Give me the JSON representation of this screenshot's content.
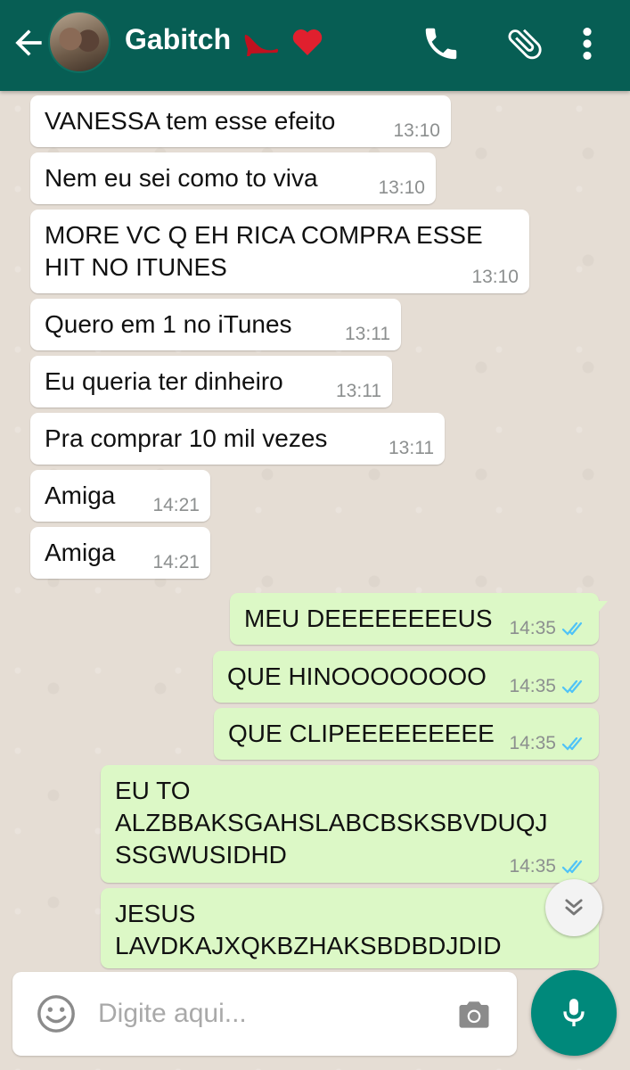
{
  "header": {
    "contact_name": "Gabitch",
    "name_emojis": [
      "high-heel-icon",
      "heart-icon"
    ],
    "icons": [
      "back-arrow-icon",
      "phone-icon",
      "paperclip-icon",
      "more-vert-icon"
    ]
  },
  "messages": [
    {
      "dir": "in",
      "text": "VANESSA tem esse efeito",
      "time": "13:10"
    },
    {
      "dir": "in",
      "text": "Nem eu sei como to viva",
      "time": "13:10"
    },
    {
      "dir": "in",
      "text": "MORE VC Q EH RICA COMPRA ESSE\nHIT NO ITUNES",
      "time": "13:10"
    },
    {
      "dir": "in",
      "text": "Quero em 1 no iTunes",
      "time": "13:11"
    },
    {
      "dir": "in",
      "text": "Eu queria ter dinheiro",
      "time": "13:11"
    },
    {
      "dir": "in",
      "text": "Pra comprar 10 mil vezes",
      "time": "13:11"
    },
    {
      "dir": "in",
      "text": "Amiga",
      "time": "14:21"
    },
    {
      "dir": "in",
      "text": "Amiga",
      "time": "14:21"
    },
    {
      "dir": "out",
      "text": "MEU DEEEEEEEEUS",
      "time": "14:35",
      "status": "read"
    },
    {
      "dir": "out",
      "text": "QUE HINOOOOOOOO",
      "time": "14:35",
      "status": "read"
    },
    {
      "dir": "out",
      "text": "QUE CLIPEEEEEEEEE",
      "time": "14:35",
      "status": "read"
    },
    {
      "dir": "out",
      "text": "EU TO\nALZBBAKSGAHSLABCBSKSBVDUQJ\nSSGWUSIDHD",
      "time": "14:35",
      "status": "read"
    },
    {
      "dir": "out",
      "text": "JESUS\nLAVDKAJXQKBZHAKSBDBDJDID",
      "time": "",
      "status": ""
    }
  ],
  "input": {
    "placeholder": "Digite aqui...",
    "value": ""
  },
  "colors": {
    "header_bg": "#075e54",
    "incoming_bubble": "#ffffff",
    "outgoing_bubble": "#dcf8c6",
    "read_ticks": "#4fc3f7",
    "mic_button": "#00897b"
  }
}
